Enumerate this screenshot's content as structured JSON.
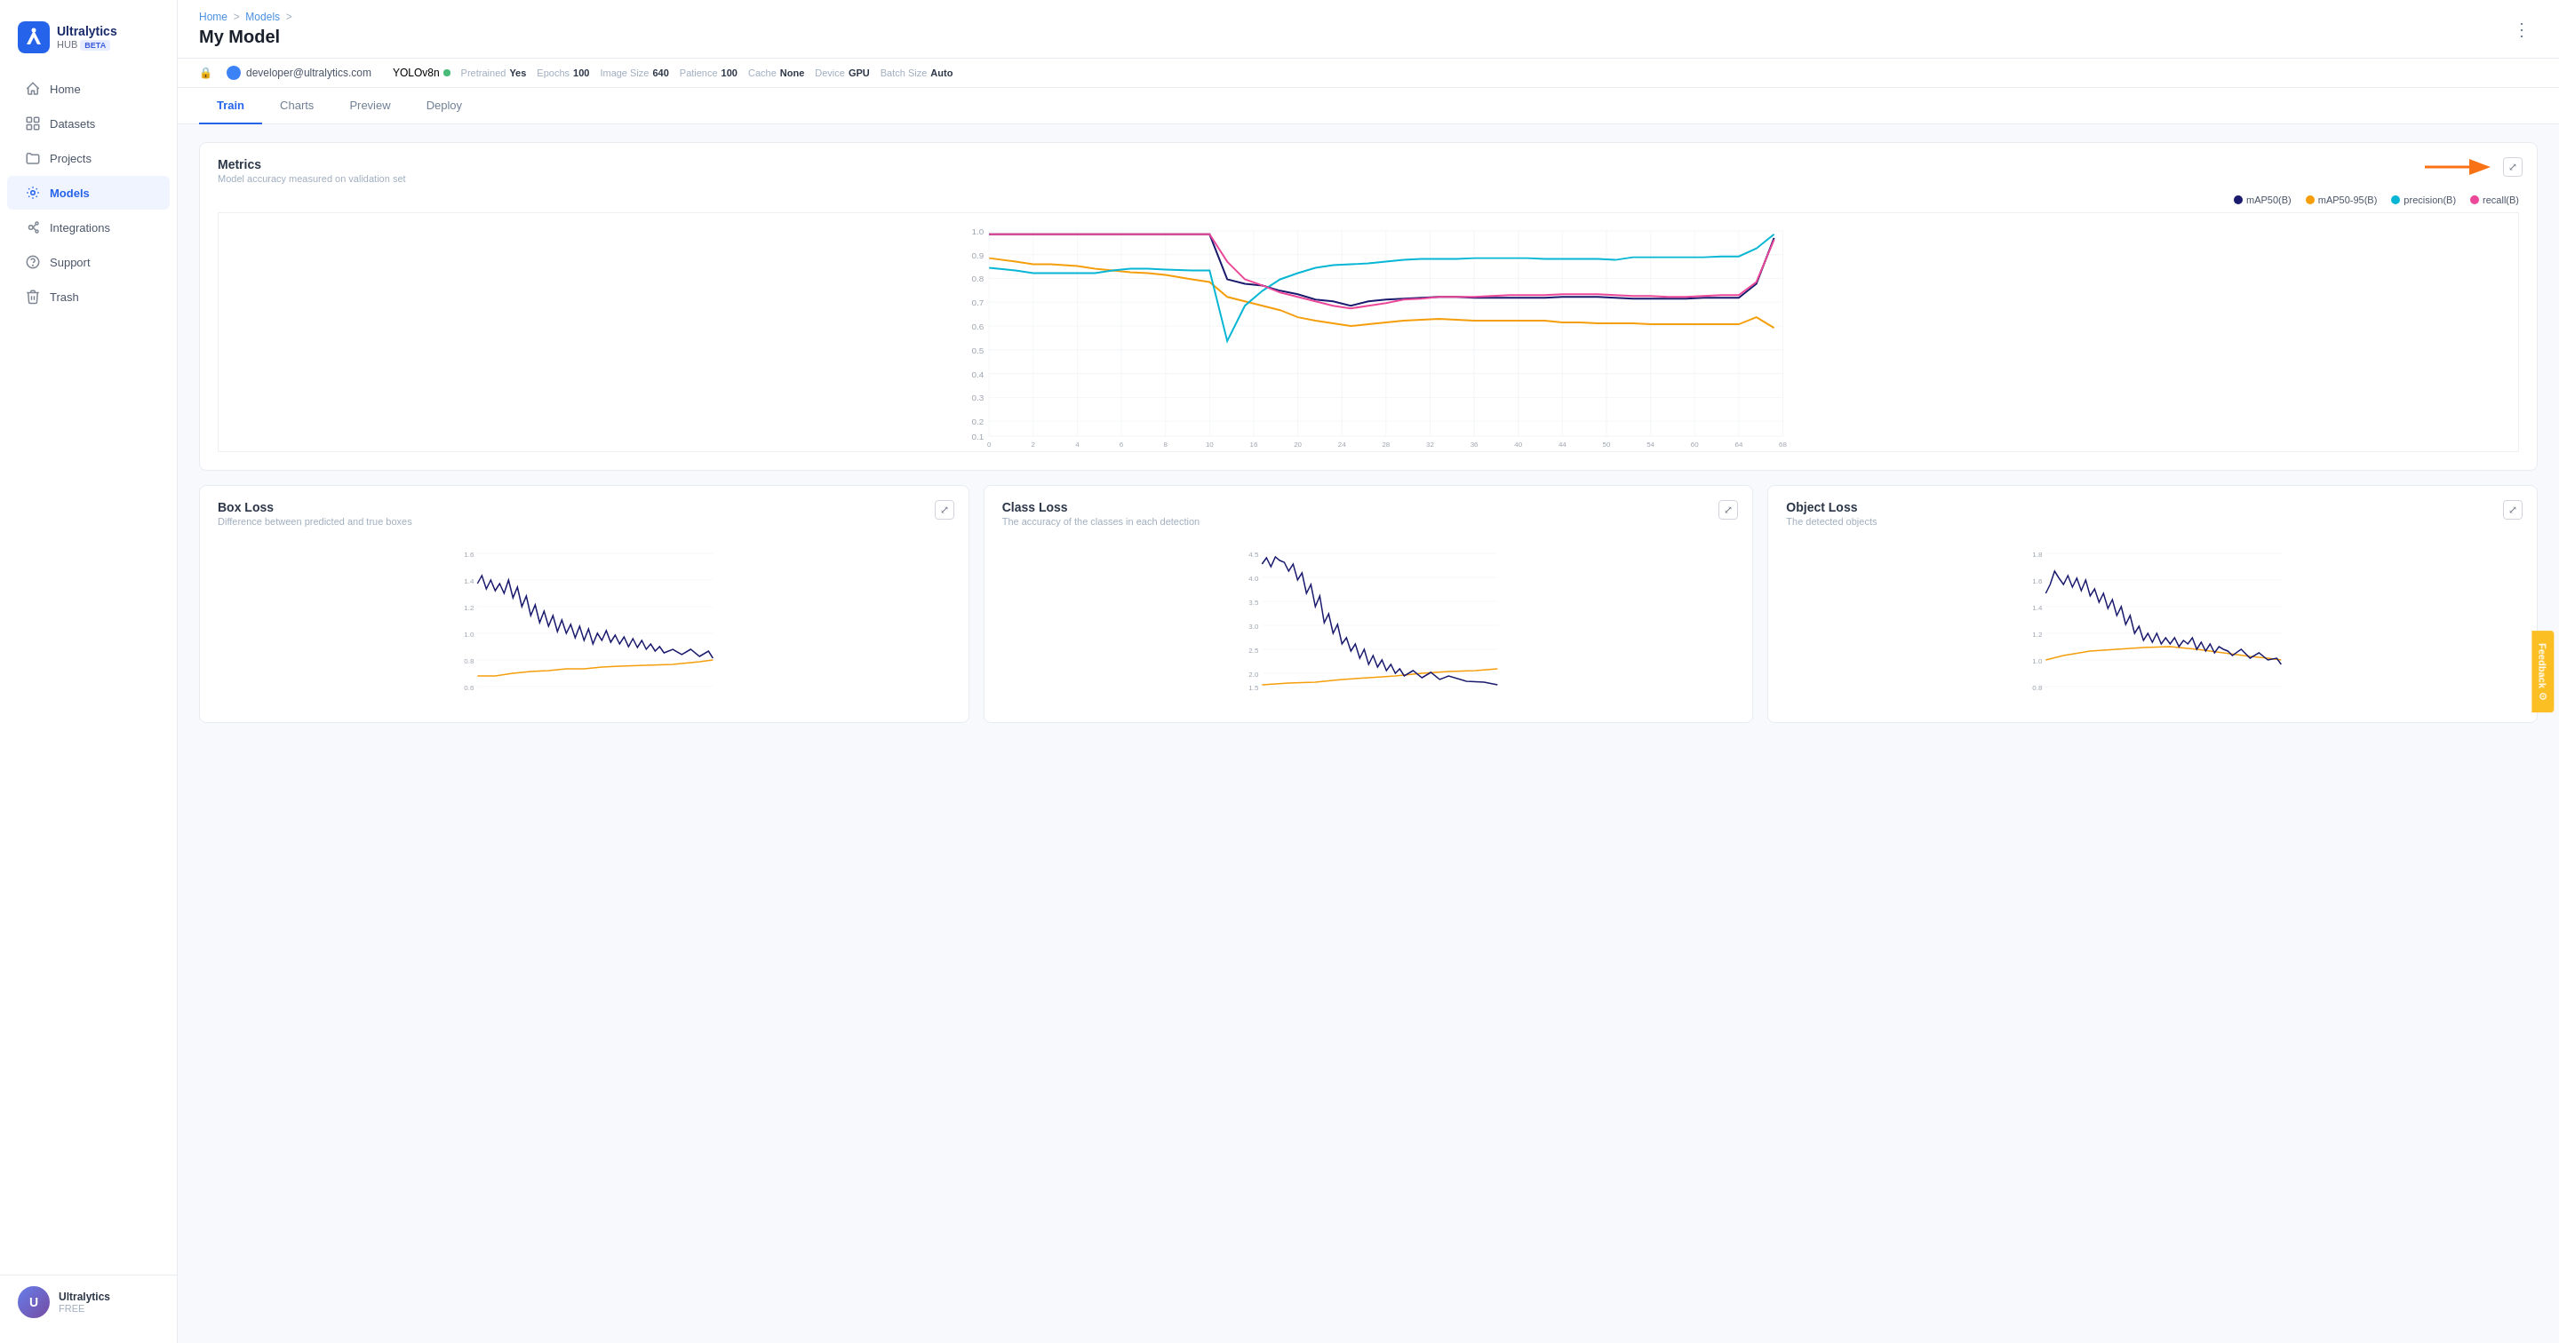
{
  "sidebar": {
    "logo": {
      "name": "Ultralytics",
      "sub": "HUB",
      "badge": "BETA"
    },
    "nav": [
      {
        "id": "home",
        "label": "Home",
        "icon": "home",
        "active": false
      },
      {
        "id": "datasets",
        "label": "Datasets",
        "icon": "datasets",
        "active": false
      },
      {
        "id": "projects",
        "label": "Projects",
        "icon": "projects",
        "active": false
      },
      {
        "id": "models",
        "label": "Models",
        "icon": "models",
        "active": true
      },
      {
        "id": "integrations",
        "label": "Integrations",
        "icon": "integrations",
        "active": false
      },
      {
        "id": "support",
        "label": "Support",
        "icon": "support",
        "active": false
      },
      {
        "id": "trash",
        "label": "Trash",
        "icon": "trash",
        "active": false
      }
    ],
    "user": {
      "name": "Ultralytics",
      "plan": "FREE"
    }
  },
  "breadcrumb": {
    "items": [
      "Home",
      "Models"
    ],
    "separator": ">"
  },
  "page": {
    "title": "My Model"
  },
  "model_info": {
    "email": "developer@ultralytics.com",
    "model_name": "YOLOv8n",
    "pretrained_label": "Pretrained",
    "pretrained_value": "Yes",
    "epochs_label": "Epochs",
    "epochs_value": "100",
    "image_size_label": "Image Size",
    "image_size_value": "640",
    "patience_label": "Patience",
    "patience_value": "100",
    "cache_label": "Cache",
    "cache_value": "None",
    "device_label": "Device",
    "device_value": "GPU",
    "batch_size_label": "Batch Size",
    "batch_size_value": "Auto"
  },
  "tabs": [
    {
      "id": "train",
      "label": "Train",
      "active": true
    },
    {
      "id": "charts",
      "label": "Charts",
      "active": false
    },
    {
      "id": "preview",
      "label": "Preview",
      "active": false
    },
    {
      "id": "deploy",
      "label": "Deploy",
      "active": false
    }
  ],
  "metrics_chart": {
    "title": "Metrics",
    "subtitle": "Model accuracy measured on validation set",
    "legend": [
      {
        "label": "mAP50(B)",
        "color": "#1a1a6e"
      },
      {
        "label": "mAP50-95(B)",
        "color": "#f59e0b"
      },
      {
        "label": "precision(B)",
        "color": "#06b6d4"
      },
      {
        "label": "recall(B)",
        "color": "#ec4899"
      }
    ]
  },
  "box_loss_chart": {
    "title": "Box Loss",
    "subtitle": "Difference between predicted and true boxes"
  },
  "class_loss_chart": {
    "title": "Class Loss",
    "subtitle": "The accuracy of the classes in each detection"
  },
  "object_loss_chart": {
    "title": "Object Loss",
    "subtitle": "The detected objects"
  },
  "feedback": {
    "label": "Feedback"
  }
}
